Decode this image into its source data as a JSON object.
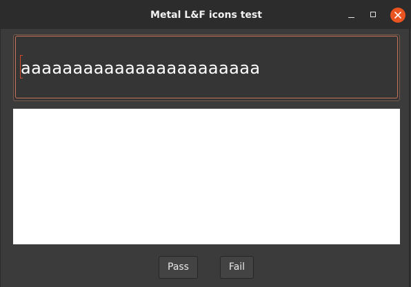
{
  "window": {
    "title": "Metal L&F icons test",
    "controls": {
      "minimize": "minimize-icon",
      "maximize": "maximize-icon",
      "close": "close-icon"
    }
  },
  "text_field": {
    "value": "aaaaaaaaaaaaaaaaaaaaaaa"
  },
  "buttons": {
    "pass": "Pass",
    "fail": "Fail"
  },
  "colors": {
    "accent": "#e95420",
    "focus_border": "#c8745a",
    "background": "#3b3b3b",
    "panel": "#ffffff"
  }
}
